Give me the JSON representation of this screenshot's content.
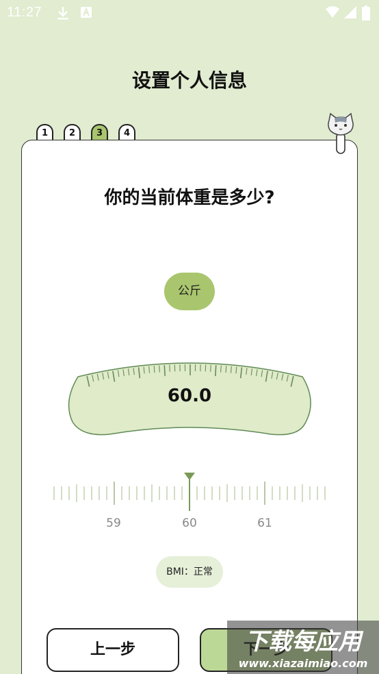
{
  "status_bar": {
    "time": "11:27",
    "icons": [
      "download-icon",
      "a-box-icon",
      "wifi-icon",
      "signal-icon",
      "battery-icon"
    ]
  },
  "header": {
    "title": "设置个人信息"
  },
  "steps": [
    {
      "label": "1",
      "active": false
    },
    {
      "label": "2",
      "active": false
    },
    {
      "label": "3",
      "active": true
    },
    {
      "label": "4",
      "active": false
    }
  ],
  "question": "你的当前体重是多少?",
  "unit": "公斤",
  "weight": {
    "value": "60.0"
  },
  "ruler": {
    "labels": [
      "59",
      "60",
      "61"
    ],
    "selected": 60
  },
  "bmi": {
    "text": "BMI：正常"
  },
  "buttons": {
    "prev": "上一步",
    "next": "下一步"
  },
  "watermark": {
    "title": "下载每应用",
    "url": "www.xiazaimiao.com"
  },
  "colors": {
    "background": "#e1ecd0",
    "accent": "#a9c66e",
    "next_button": "#bcd896",
    "scale_fill": "#dfebc9"
  }
}
